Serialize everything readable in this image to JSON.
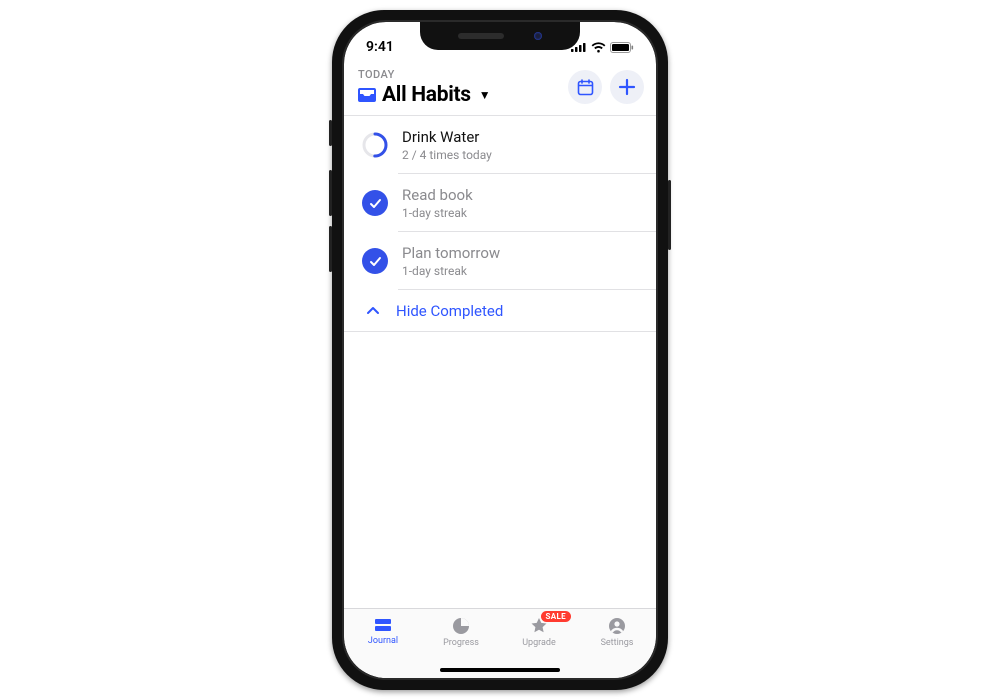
{
  "status": {
    "time": "9:41"
  },
  "header": {
    "eyebrow": "TODAY",
    "title": "All Habits"
  },
  "habits": [
    {
      "title": "Drink Water",
      "subtitle": "2 / 4 times today",
      "completed": false,
      "progress": 0.5
    },
    {
      "title": "Read book",
      "subtitle": "1-day streak",
      "completed": true
    },
    {
      "title": "Plan tomorrow",
      "subtitle": "1-day streak",
      "completed": true
    }
  ],
  "hideCompleted": {
    "label": "Hide Completed"
  },
  "tabs": [
    {
      "label": "Journal"
    },
    {
      "label": "Progress"
    },
    {
      "label": "Upgrade",
      "badge": "SALE"
    },
    {
      "label": "Settings"
    }
  ],
  "colors": {
    "accent": "#2f55ff",
    "muted": "#8a8a8e",
    "badge": "#ff3b30"
  }
}
